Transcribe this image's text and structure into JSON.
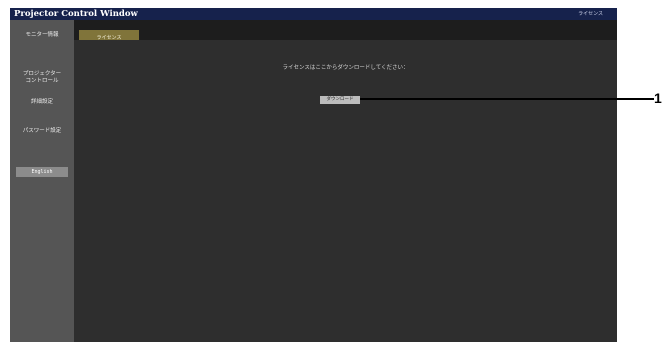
{
  "window": {
    "title": "Projector Control Window",
    "header_right": "ライセンス"
  },
  "sidebar": {
    "items": [
      {
        "label": "モニター情報"
      },
      {
        "label": "プロジェクター\nコントロール"
      },
      {
        "label": "詳細設定"
      },
      {
        "label": "パスワード設定"
      }
    ],
    "language_button": "English"
  },
  "tabs": [
    {
      "label": "ライセンス",
      "active": true
    }
  ],
  "main": {
    "message": "ライセンスはここからダウンロードしてください：",
    "download_button": "ダウンロード"
  },
  "callout": {
    "label": "1"
  },
  "colors": {
    "titlebar": "#16224c",
    "sidebar": "#555555",
    "content": "#2e2e2e",
    "active_tab": "#80743a"
  }
}
